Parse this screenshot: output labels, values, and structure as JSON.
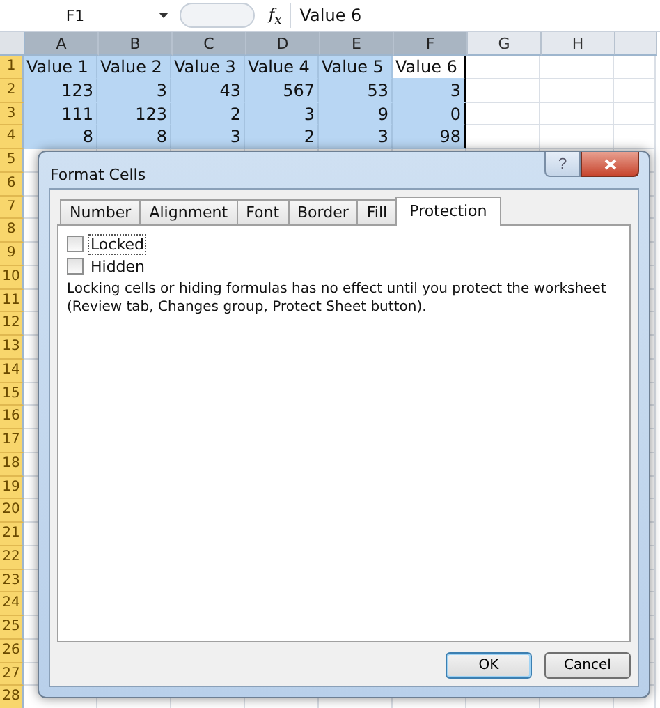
{
  "name_box": {
    "value": "F1"
  },
  "formula_bar": {
    "function_label": "f$_{x}$",
    "value": "Value 6"
  },
  "sheet": {
    "columns": [
      {
        "label": "A",
        "selected": true
      },
      {
        "label": "B",
        "selected": true
      },
      {
        "label": "C",
        "selected": true
      },
      {
        "label": "D",
        "selected": true
      },
      {
        "label": "E",
        "selected": true
      },
      {
        "label": "F",
        "selected": true
      },
      {
        "label": "G",
        "selected": false
      },
      {
        "label": "H",
        "selected": false
      }
    ],
    "rows": [
      {
        "number": "1",
        "selected": true,
        "cells": [
          {
            "value": "Value 1",
            "kind": "text",
            "selected": true,
            "active": false
          },
          {
            "value": "Value 2",
            "kind": "text",
            "selected": true,
            "active": false
          },
          {
            "value": "Value 3",
            "kind": "text",
            "selected": true,
            "active": false
          },
          {
            "value": "Value 4",
            "kind": "text",
            "selected": true,
            "active": false
          },
          {
            "value": "Value 5",
            "kind": "text",
            "selected": true,
            "active": false
          },
          {
            "value": "Value 6",
            "kind": "text",
            "selected": true,
            "active": true
          }
        ]
      },
      {
        "number": "2",
        "selected": true,
        "cells": [
          {
            "value": "123",
            "kind": "number",
            "selected": true,
            "active": false
          },
          {
            "value": "3",
            "kind": "number",
            "selected": true,
            "active": false
          },
          {
            "value": "43",
            "kind": "number",
            "selected": true,
            "active": false
          },
          {
            "value": "567",
            "kind": "number",
            "selected": true,
            "active": false
          },
          {
            "value": "53",
            "kind": "number",
            "selected": true,
            "active": false
          },
          {
            "value": "3",
            "kind": "number",
            "selected": true,
            "active": false
          }
        ]
      },
      {
        "number": "3",
        "selected": true,
        "cells": [
          {
            "value": "111",
            "kind": "number",
            "selected": true,
            "active": false
          },
          {
            "value": "123",
            "kind": "number",
            "selected": true,
            "active": false
          },
          {
            "value": "2",
            "kind": "number",
            "selected": true,
            "active": false
          },
          {
            "value": "3",
            "kind": "number",
            "selected": true,
            "active": false
          },
          {
            "value": "9",
            "kind": "number",
            "selected": true,
            "active": false
          },
          {
            "value": "0",
            "kind": "number",
            "selected": true,
            "active": false
          }
        ]
      },
      {
        "number": "4",
        "selected": true,
        "cells": [
          {
            "value": "8",
            "kind": "number",
            "selected": true,
            "active": false
          },
          {
            "value": "8",
            "kind": "number",
            "selected": true,
            "active": false
          },
          {
            "value": "3",
            "kind": "number",
            "selected": true,
            "active": false
          },
          {
            "value": "2",
            "kind": "number",
            "selected": true,
            "active": false
          },
          {
            "value": "3",
            "kind": "number",
            "selected": true,
            "active": false
          },
          {
            "value": "98",
            "kind": "number",
            "selected": true,
            "active": false
          }
        ]
      },
      {
        "number": "5",
        "selected": true
      },
      {
        "number": "6",
        "selected": true
      },
      {
        "number": "7",
        "selected": true
      },
      {
        "number": "8",
        "selected": true
      },
      {
        "number": "9",
        "selected": true
      },
      {
        "number": "10",
        "selected": true
      },
      {
        "number": "11",
        "selected": true
      },
      {
        "number": "12",
        "selected": true
      },
      {
        "number": "13",
        "selected": true
      },
      {
        "number": "14",
        "selected": true
      },
      {
        "number": "15",
        "selected": true
      },
      {
        "number": "16",
        "selected": true
      },
      {
        "number": "17",
        "selected": true
      },
      {
        "number": "18",
        "selected": true
      },
      {
        "number": "19",
        "selected": true
      },
      {
        "number": "20",
        "selected": true
      },
      {
        "number": "21",
        "selected": true
      },
      {
        "number": "22",
        "selected": true
      },
      {
        "number": "23",
        "selected": true
      },
      {
        "number": "24",
        "selected": true
      },
      {
        "number": "25",
        "selected": true
      },
      {
        "number": "26",
        "selected": true
      },
      {
        "number": "27",
        "selected": true
      },
      {
        "number": "28",
        "selected": true
      }
    ]
  },
  "dialog": {
    "title": "Format Cells",
    "help_button": "?",
    "tabs": [
      {
        "label": "Number",
        "selected": false
      },
      {
        "label": "Alignment",
        "selected": false
      },
      {
        "label": "Font",
        "selected": false
      },
      {
        "label": "Border",
        "selected": false
      },
      {
        "label": "Fill",
        "selected": false
      },
      {
        "label": "Protection",
        "selected": true
      }
    ],
    "checkboxes": [
      {
        "label": "Locked",
        "checked": false,
        "focused": true
      },
      {
        "label": "Hidden",
        "checked": false,
        "focused": false
      }
    ],
    "note": "Locking cells or hiding formulas has no effect until you protect the worksheet (Review tab, Changes group, Protect Sheet button).",
    "buttons": [
      {
        "label": "OK",
        "default": true
      },
      {
        "label": "Cancel",
        "default": false
      }
    ]
  }
}
